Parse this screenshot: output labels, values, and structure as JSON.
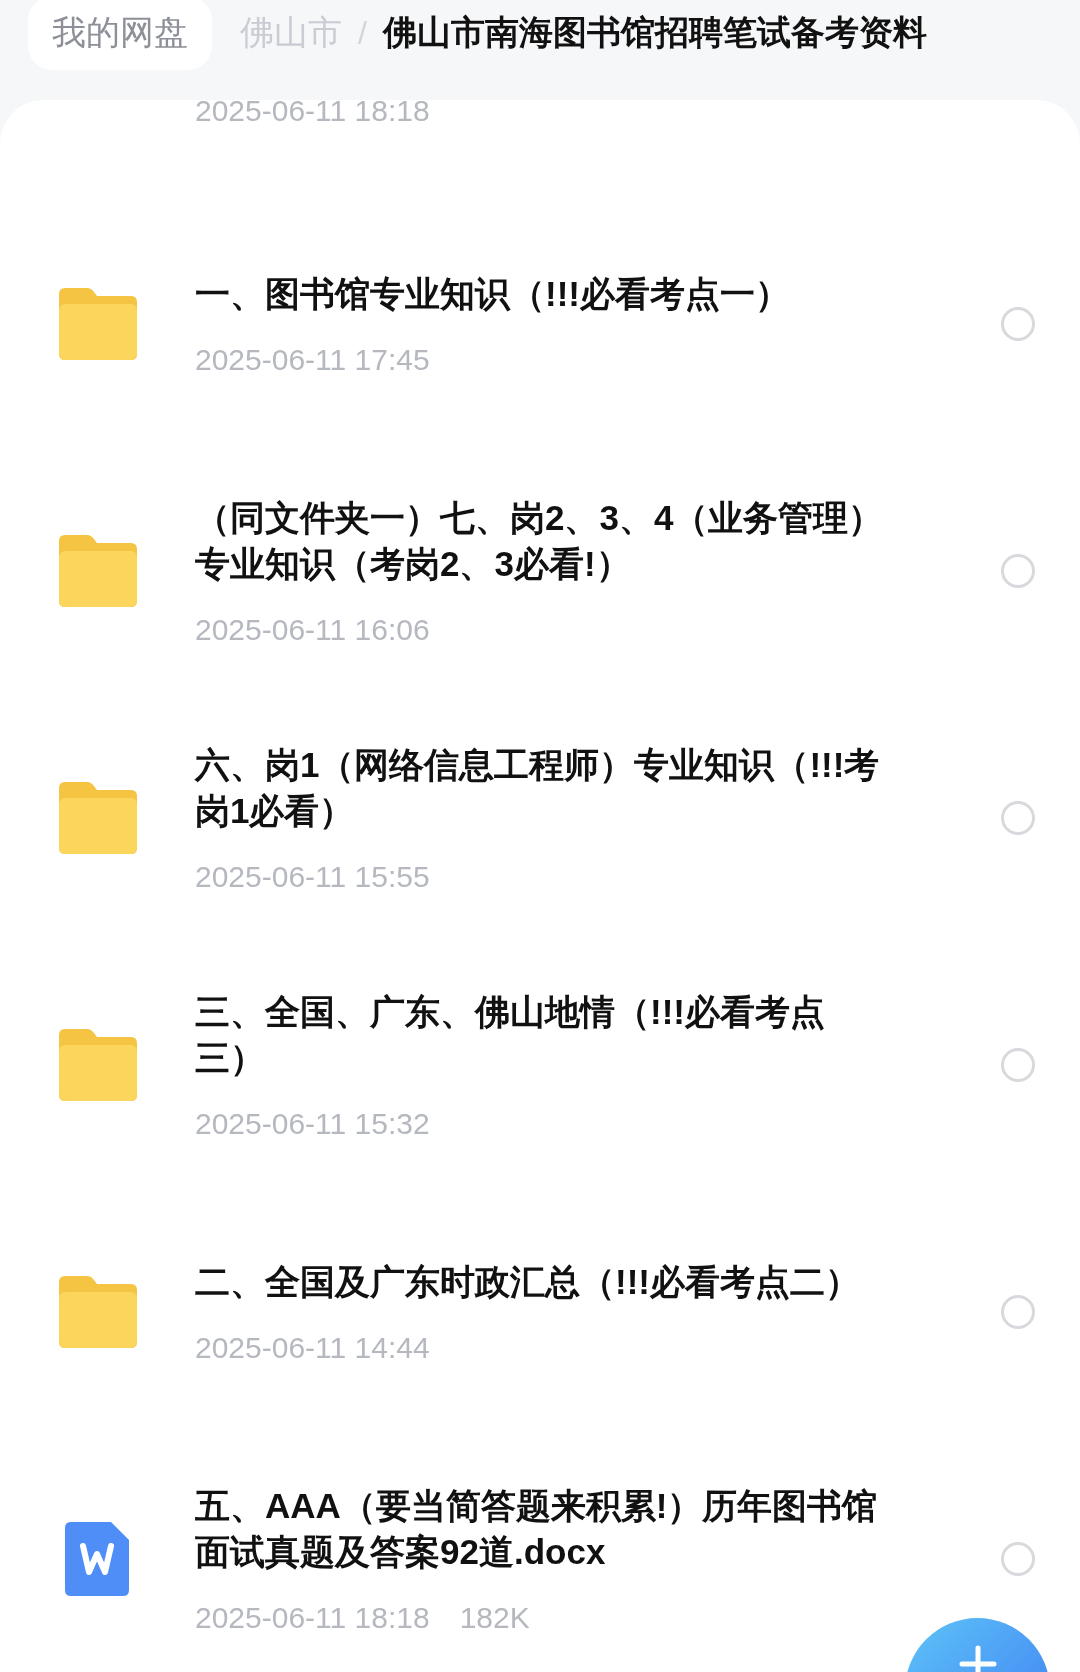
{
  "breadcrumb": {
    "root": "我的网盘",
    "parent": "佛山市",
    "separator": "/",
    "current": "佛山市南海图书馆招聘笔试备考资料"
  },
  "partial_item": {
    "date": "2025-06-11 18:18"
  },
  "items": [
    {
      "kind": "folder",
      "name": "一、图书馆专业知识（!!!必看考点一）",
      "date": "2025-06-11 17:45",
      "selected": false
    },
    {
      "kind": "folder",
      "name": "（同文件夹一）七、岗2、3、4（业务管理）专业知识（考岗2、3必看!）",
      "date": "2025-06-11 16:06",
      "selected": false
    },
    {
      "kind": "folder",
      "name": "六、岗1（网络信息工程师）专业知识（!!!考岗1必看）",
      "date": "2025-06-11 15:55",
      "selected": false
    },
    {
      "kind": "folder",
      "name": "三、全国、广东、佛山地情（!!!必看考点三）",
      "date": "2025-06-11 15:32",
      "selected": false
    },
    {
      "kind": "folder",
      "name": "二、全国及广东时政汇总（!!!必看考点二）",
      "date": "2025-06-11 14:44",
      "selected": false
    },
    {
      "kind": "doc",
      "name": "五、AAA（要当简答题来积累!）历年图书馆面试真题及答案92道.docx",
      "date": "2025-06-11 18:18",
      "size": "182K",
      "selected": false
    }
  ]
}
